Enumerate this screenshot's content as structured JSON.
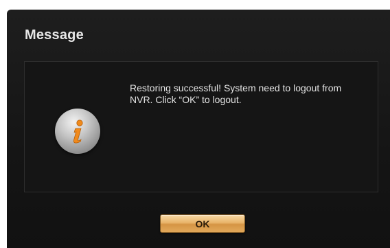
{
  "dialog": {
    "title": "Message",
    "message": "Restoring successful! System need to logout from NVR. Click “OK” to logout.",
    "icon": "info-icon",
    "ok_label": "OK"
  },
  "colors": {
    "dialog_background": "#1a1a1a",
    "accent_button": "#e9b46a",
    "icon_glyph": "#f08a1c",
    "text": "#e2e2e2"
  }
}
